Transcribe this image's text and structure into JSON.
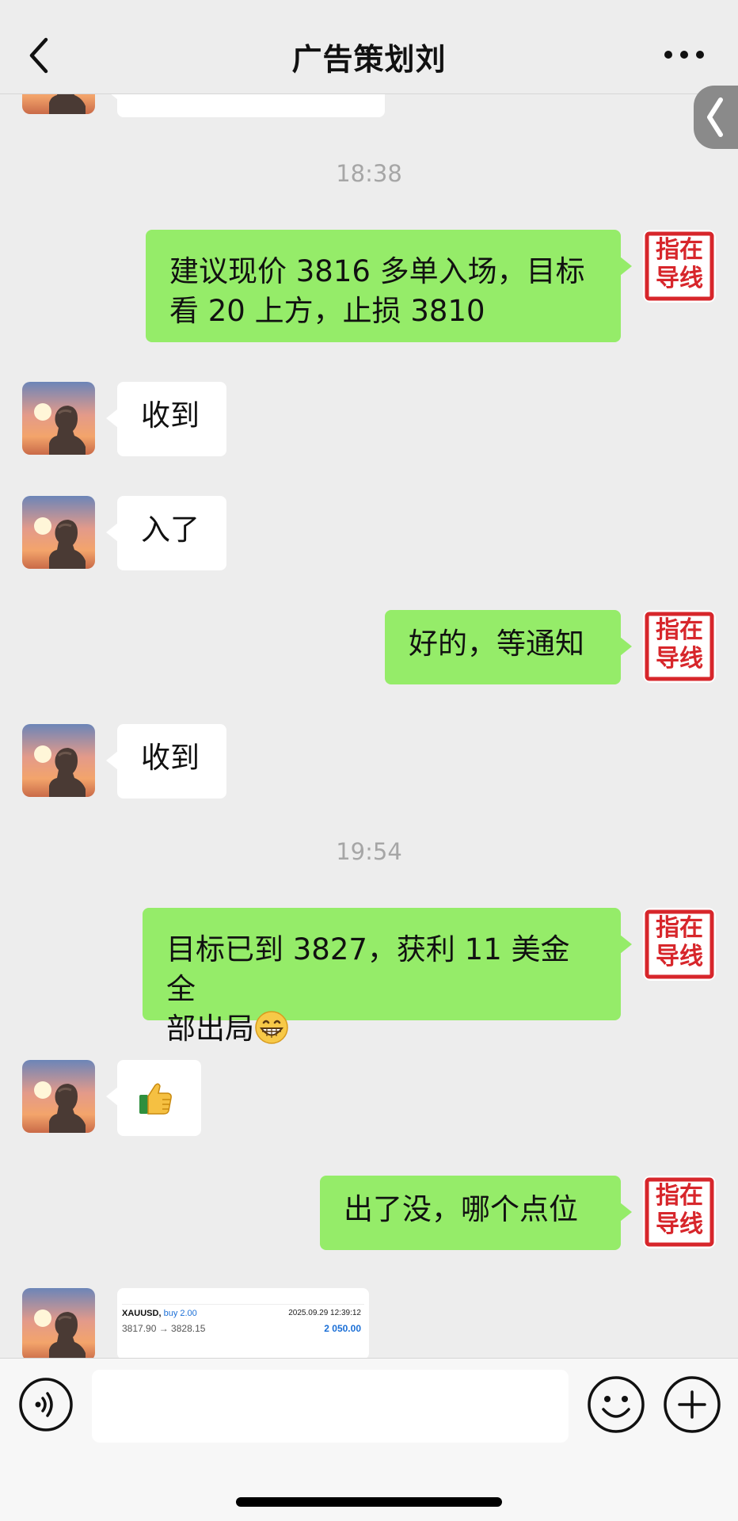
{
  "header": {
    "title": "广告策划刘",
    "back_icon": "chevron-left-icon",
    "more_icon": "more-dots-icon",
    "side_tab_icon": "side-chevron-icon"
  },
  "avatar_icon": "sunset-statue-avatar",
  "stamp": {
    "text": "指在导线",
    "line1": "指在",
    "line2": "导线",
    "color": "#d7262b"
  },
  "colors": {
    "outgoing_bubble": "#95ec69",
    "incoming_bubble": "#ffffff",
    "background": "#ededed"
  },
  "messages": [
    {
      "type": "time",
      "text": "18:38"
    },
    {
      "type": "out",
      "line1": "建议现价 3816 多单入场，目标",
      "line2": "看 20 上方，止损 3810"
    },
    {
      "type": "in",
      "text": "收到"
    },
    {
      "type": "in",
      "text": "入了"
    },
    {
      "type": "out",
      "text": "好的，等通知"
    },
    {
      "type": "in",
      "text": "收到"
    },
    {
      "type": "time",
      "text": "19:54"
    },
    {
      "type": "out",
      "line1": "目标已到 3827，获利 11 美金全",
      "line2": "部出局",
      "emoji": "grinning-face-icon"
    },
    {
      "type": "in",
      "icon": "thumbs-up-icon"
    },
    {
      "type": "out",
      "text": "出了没，哪个点位"
    }
  ],
  "trade": {
    "symbol": "XAUUSD,",
    "direction": "buy 2.00",
    "datetime": "2025.09.29 12:39:12",
    "prices": "3817.90 → 3828.15",
    "profit": "2 050.00"
  },
  "input_bar": {
    "voice_icon": "voice-icon",
    "placeholder": "",
    "emoji_icon": "smiley-icon",
    "plus_icon": "plus-icon"
  }
}
